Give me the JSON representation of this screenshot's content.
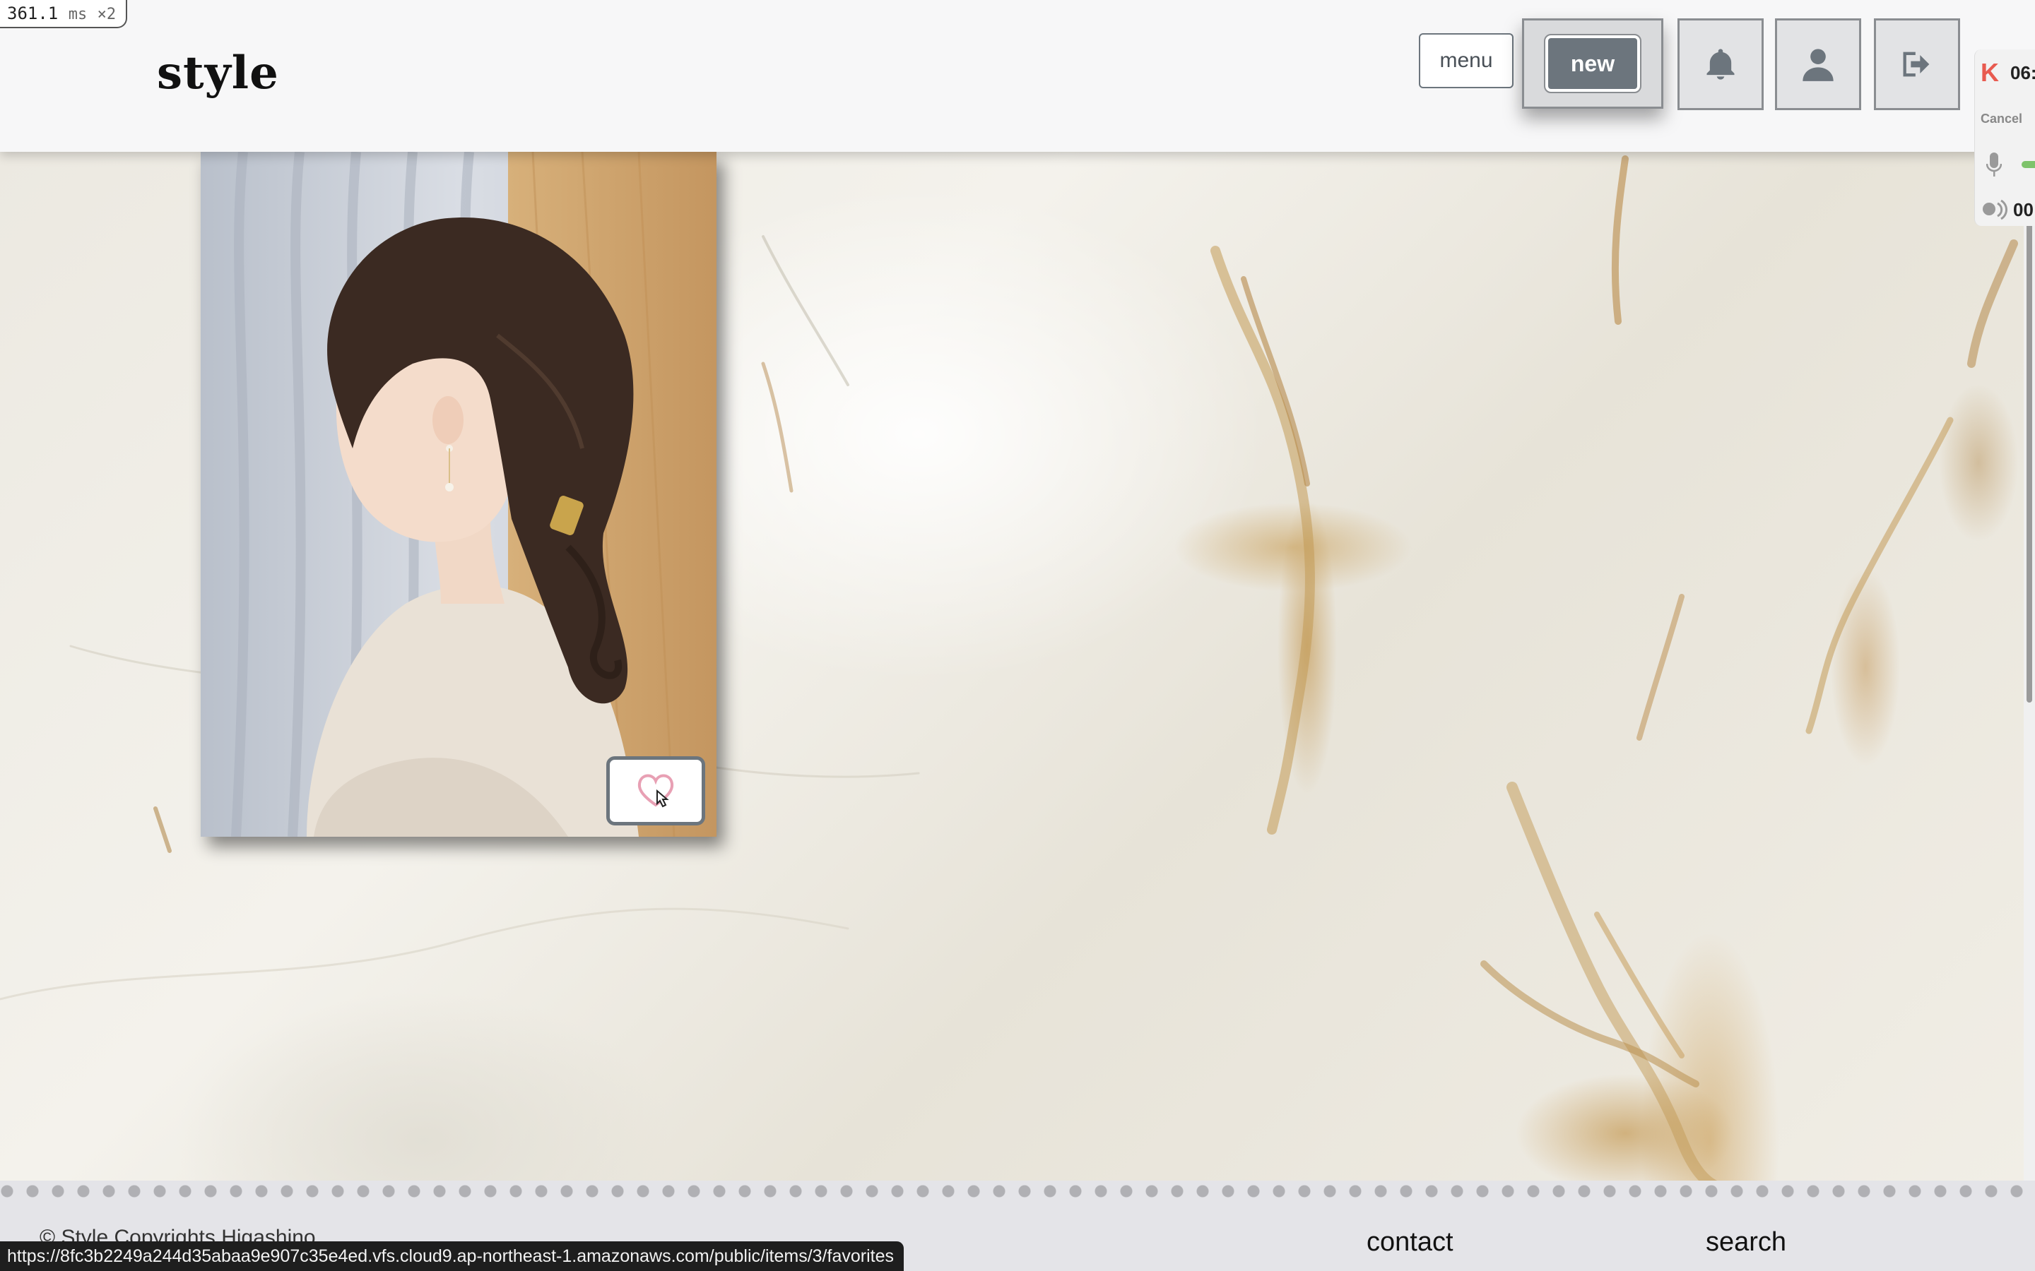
{
  "perf_badge": {
    "value": "361.1",
    "unit": "ms",
    "scale": "×2"
  },
  "header": {
    "brand": "style",
    "menu_label": "menu",
    "new_label": "new",
    "icons": [
      "bell-icon",
      "user-icon",
      "logout-icon"
    ]
  },
  "recorder": {
    "logo": "K",
    "time_top": "06:",
    "cancel_label": "Cancel",
    "time_bottom": "00"
  },
  "post": {
    "favorite_icon": "heart-icon"
  },
  "footer": {
    "copyright": "© Style Copyrights Higashino",
    "links": [
      "contact",
      "search"
    ]
  },
  "status_url": "https://8fc3b2249a244d35abaa9e907c35e4ed.vfs.cloud9.ap-northeast-1.amazonaws.com/public/items/3/favorites",
  "colors": {
    "secondary": "#6c757d",
    "header_bg": "#f7f7f8",
    "footer_bg": "#e4e4e8",
    "heart": "#e8a0b4"
  }
}
